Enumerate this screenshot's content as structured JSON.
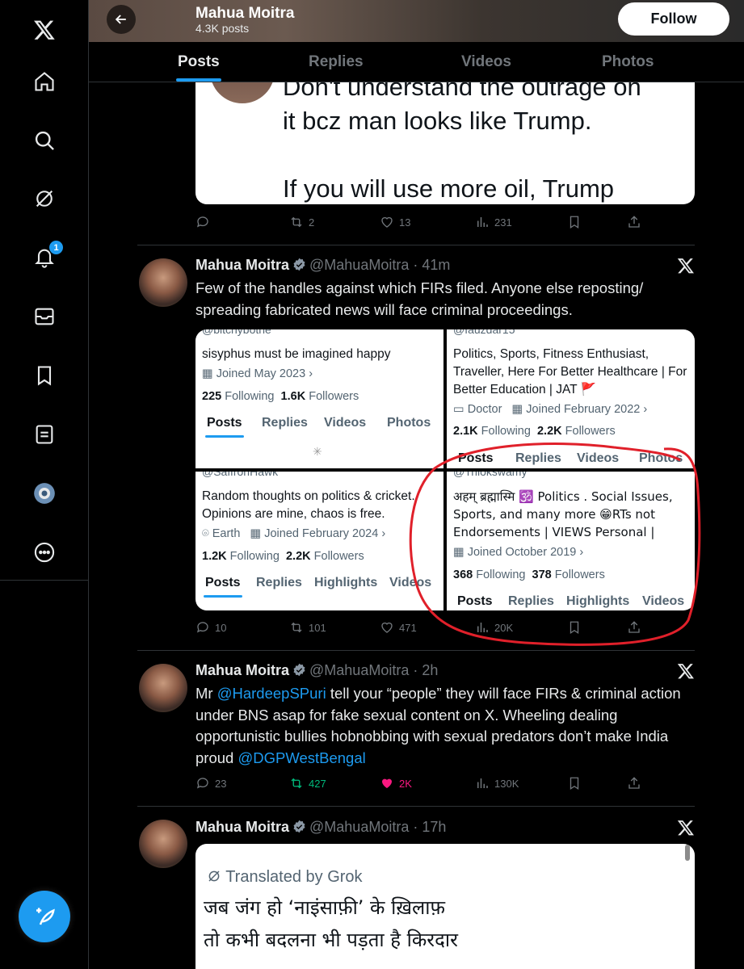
{
  "header": {
    "name": "Mahua Moitra",
    "posts_count": "4.3K posts",
    "follow_label": "Follow"
  },
  "tabs": [
    {
      "label": "Posts",
      "active": true
    },
    {
      "label": "Replies",
      "active": false
    },
    {
      "label": "Videos",
      "active": false
    },
    {
      "label": "Photos",
      "active": false
    }
  ],
  "sidebar": {
    "icons": [
      "x-logo-icon",
      "home-icon",
      "search-icon",
      "grok-icon",
      "bell-icon",
      "mail-icon",
      "bookmark-icon",
      "lists-icon",
      "profile-avatar-icon",
      "more-icon"
    ],
    "notification_count": "1"
  },
  "tweet_prev": {
    "media_lines": [
      "Don't understand the outrage on",
      "it bcz man looks like Trump.",
      "If you will use more oil, Trump"
    ],
    "retweets": "2",
    "likes": "13",
    "views": "231"
  },
  "tweet1": {
    "name": "Mahua Moitra",
    "handle": "@MahuaMoitra",
    "time": "41m",
    "text": "Few of the handles against which FIRs filed. Anyone else reposting/ spreading fabricated news will face criminal proceedings.",
    "replies": "10",
    "retweets": "101",
    "likes": "471",
    "views": "20K",
    "cards": [
      {
        "handle_partial": "@bitchybothe",
        "bio": "sisyphus must be imagined happy",
        "joined": "Joined May 2023",
        "following": "225",
        "followers": "1.6K",
        "following_label": "Following",
        "followers_label": "Followers",
        "tabs": [
          "Posts",
          "Replies",
          "Videos",
          "Photos"
        ]
      },
      {
        "handle_partial": "@fauzdar15",
        "bio": "Politics, Sports, Fitness Enthusiast, Traveller, Here For Better Healthcare | For Better Education | JAT 🚩",
        "profession": "Doctor",
        "joined": "Joined February 2022",
        "following": "2.1K",
        "followers": "2.2K",
        "following_label": "Following",
        "followers_label": "Followers",
        "tabs": [
          "Posts",
          "Replies",
          "Videos",
          "Photos"
        ]
      },
      {
        "handle_partial": "@SaffronHawk",
        "bio": "Random thoughts on politics & cricket. Opinions are mine, chaos is free.",
        "location": "Earth",
        "joined": "Joined February 2024",
        "following": "1.2K",
        "followers": "2.2K",
        "following_label": "Following",
        "followers_label": "Followers",
        "tabs": [
          "Posts",
          "Replies",
          "Highlights",
          "Videos"
        ]
      },
      {
        "handle_partial": "@Trilokswamy",
        "bio": "अहम् ब्रह्मास्मि 🕉️ Politics . Social Issues, Sports, and many more 😁RTs not Endorsements | VIEWS Personal |",
        "joined": "Joined October 2019",
        "following": "368",
        "followers": "378",
        "following_label": "Following",
        "followers_label": "Followers",
        "tabs": [
          "Posts",
          "Replies",
          "Highlights",
          "Videos"
        ]
      }
    ]
  },
  "tweet2": {
    "name": "Mahua Moitra",
    "handle": "@MahuaMoitra",
    "time": "2h",
    "text_pre": "Mr ",
    "mention1": "@HardeepSPuri",
    "text_mid": " tell your “people” they will face FIRs & criminal action under BNS asap for fake sexual content on X. Wheeling dealing opportunistic bullies hobnobbing with sexual predators don’t make India proud ",
    "mention2": "@DGPWestBengal",
    "replies": "23",
    "retweets": "427",
    "likes": "2K",
    "views": "130K"
  },
  "tweet3": {
    "name": "Mahua Moitra",
    "handle": "@MahuaMoitra",
    "time": "17h",
    "translated_by": "Translated by Grok",
    "line1": "जब जंग हो ‘नाइंसाफ़ी’ के ख़िलाफ़",
    "line2": "तो कभी बदलना भी पड़ता है किरदार"
  },
  "colors": {
    "accent": "#1d9bf0",
    "retweet_active": "#00ba7c",
    "like_active": "#f91880",
    "annotation_red": "#e0202a"
  }
}
